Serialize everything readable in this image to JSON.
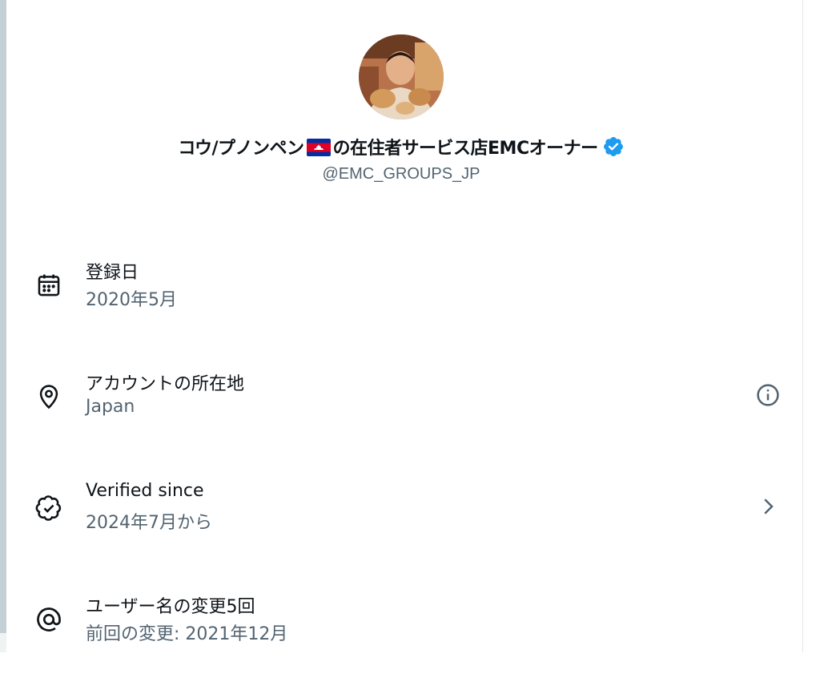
{
  "profile": {
    "name_part1": "コウ/プノンペン",
    "name_part2": "の在住者サービス店EMCオーナー",
    "handle": "@EMC_GROUPS_JP",
    "flag_icon": "cambodia-flag-icon",
    "badge_icon": "verified-badge-icon",
    "badge_color": "#1d9bf0"
  },
  "rows": [
    {
      "icon": "calendar-icon",
      "title": "登録日",
      "value": "2020年5月"
    },
    {
      "icon": "location-pin-icon",
      "title": "アカウントの所在地",
      "value": "Japan",
      "action_icon": "info-icon"
    },
    {
      "icon": "verified-outline-icon",
      "title": "Verified since",
      "value": "2024年7月から",
      "action_icon": "chevron-right-icon"
    },
    {
      "icon": "at-sign-icon",
      "title": "ユーザー名の変更5回",
      "value": "前回の変更: 2021年12月"
    }
  ],
  "colors": {
    "primary_text": "#0f1419",
    "secondary_text": "#536471"
  }
}
